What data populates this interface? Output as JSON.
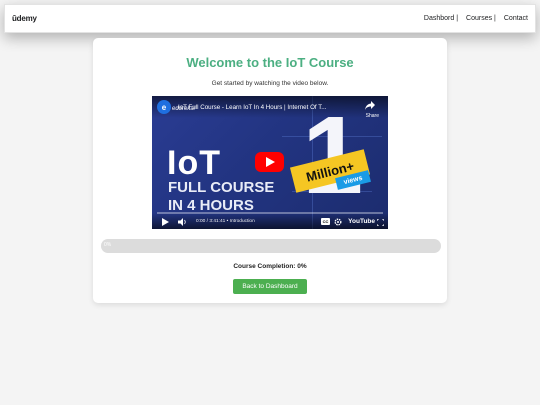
{
  "navbar": {
    "logo": "ūdemy",
    "links": [
      "Dashbord |",
      "Courses |",
      "Contact"
    ]
  },
  "main": {
    "title": "Welcome to the IoT Course",
    "subtitle": "Get started by watching the video below.",
    "video": {
      "title": "IoT Full Course - Learn IoT In 4 Hours | Internet Of T...",
      "channel": "edureka!",
      "share_label": "Share",
      "headline_1": "IoT",
      "headline_2": "FULL COURSE",
      "headline_3": "IN 4 HOURS",
      "badge_number": "1",
      "badge_text": "Million+",
      "badge_sub": "views",
      "time": "0:00 / 3:41:41 • Introduction",
      "brand": "YouTube",
      "cc_label": "CC"
    },
    "progress": {
      "value": 0,
      "label": "0%"
    },
    "completion_text": "Course Completion: 0%",
    "dashboard_button": "Back to Dashboard"
  },
  "colors": {
    "accent": "#4caf82",
    "button": "#4caf50",
    "youtube_red": "#ff0000",
    "banner_yellow": "#f5c623"
  }
}
